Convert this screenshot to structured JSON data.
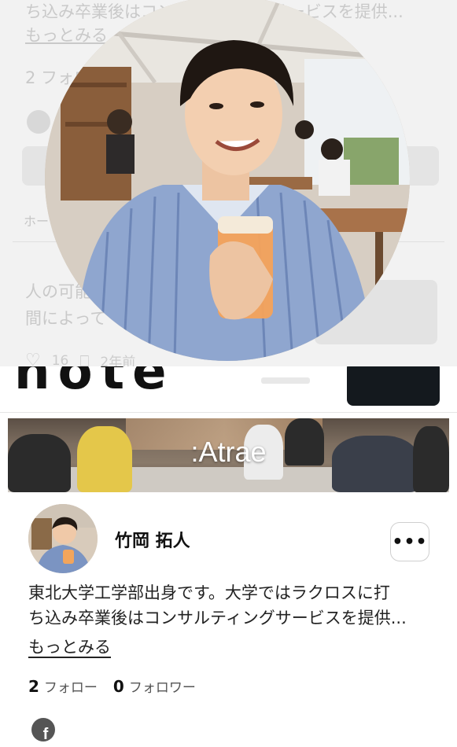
{
  "background_page": {
    "bio_line_partial": "ち込み卒業後はコンサルティングサービスを提供...",
    "more_link_partial": "もっとみる",
    "follow_partial": "2 フォロー",
    "tab_partial": "ホー",
    "article_line1": "人の可能",
    "article_line2": "間によって",
    "likes": "16",
    "time_ago": "2年前"
  },
  "banner": {
    "title": ":Atrae"
  },
  "profile": {
    "name": "竹岡 拓人",
    "more_button": "•••",
    "bio_line1": "東北大学工学部出身です。大学ではラクロスに打",
    "bio_line2": "ち込み卒業後はコンサルティングサービスを提供...",
    "more_link": "もっとみる",
    "following_count": "2",
    "following_label": "フォロー",
    "followers_count": "0",
    "followers_label": "フォロワー",
    "social_icon": "facebook-icon"
  }
}
